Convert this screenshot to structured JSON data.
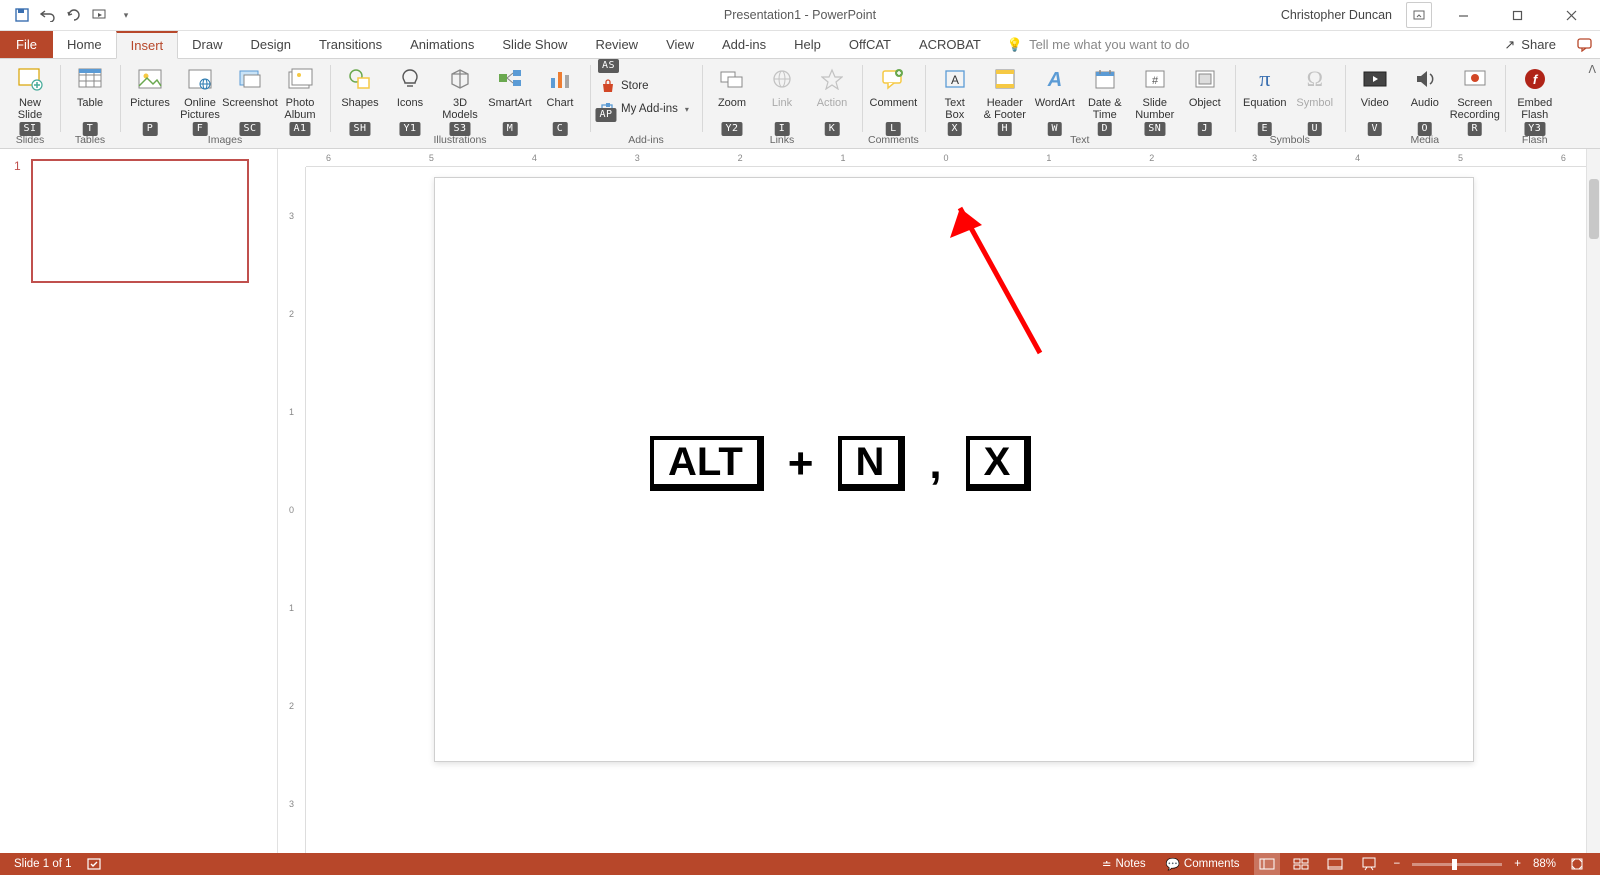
{
  "titlebar": {
    "doc_title": "Presentation1 - PowerPoint",
    "user": "Christopher Duncan"
  },
  "tabs": {
    "file": "File",
    "items": [
      "Home",
      "Insert",
      "Draw",
      "Design",
      "Transitions",
      "Animations",
      "Slide Show",
      "Review",
      "View",
      "Add-ins",
      "Help",
      "OffCAT",
      "ACROBAT"
    ],
    "active_index": 1,
    "tellme_placeholder": "Tell me what you want to do",
    "share": "Share"
  },
  "ribbon": {
    "groups": {
      "slides": {
        "label": "Slides",
        "new_slide": "New\nSlide",
        "keytip_newslide": "SI"
      },
      "tables": {
        "label": "Tables",
        "table": "Table",
        "keytip": "T"
      },
      "images": {
        "label": "Images",
        "pictures": "Pictures",
        "online_pictures": "Online\nPictures",
        "screenshot": "Screenshot",
        "photo_album": "Photo\nAlbum",
        "keytips": {
          "pictures": "P",
          "online": "F",
          "screenshot": "SC",
          "album": "A1"
        }
      },
      "illustrations": {
        "label": "Illustrations",
        "shapes": "Shapes",
        "icons": "Icons",
        "models": "3D\nModels",
        "smartart": "SmartArt",
        "chart": "Chart",
        "keytips": {
          "shapes": "SH",
          "icons": "Y1",
          "models": "S3",
          "smartart": "M",
          "chart": "C"
        }
      },
      "addins": {
        "label": "Add-ins",
        "store": "Store",
        "myaddins": "My Add-ins",
        "keytips": {
          "store": "AS",
          "myaddins": "AP"
        }
      },
      "links": {
        "label": "Links",
        "zoom": "Zoom",
        "link": "Link",
        "action": "Action",
        "keytips": {
          "zoom": "Y2",
          "link": "I",
          "action": "K"
        }
      },
      "comments": {
        "label": "Comments",
        "comment": "Comment",
        "keytip": "L"
      },
      "text": {
        "label": "Text",
        "textbox": "Text\nBox",
        "header": "Header\n& Footer",
        "wordart": "WordArt",
        "datetime": "Date &\nTime",
        "slidenum": "Slide\nNumber",
        "object": "Object",
        "keytips": {
          "textbox": "X",
          "header": "H",
          "wordart": "W",
          "datetime": "D",
          "slidenum": "SN",
          "object": "J"
        }
      },
      "symbols": {
        "label": "Symbols",
        "equation": "Equation",
        "symbol": "Symbol",
        "keytips": {
          "equation": "E",
          "symbol": "U"
        }
      },
      "media": {
        "label": "Media",
        "video": "Video",
        "audio": "Audio",
        "screenrec": "Screen\nRecording",
        "keytips": {
          "video": "V",
          "audio": "O",
          "screenrec": "R"
        }
      },
      "flash": {
        "label": "Flash",
        "embed": "Embed\nFlash",
        "keytip": "Y3"
      }
    }
  },
  "ruler_h": [
    "6",
    "5",
    "4",
    "3",
    "2",
    "1",
    "0",
    "1",
    "2",
    "3",
    "4",
    "5",
    "6"
  ],
  "ruler_v": [
    "3",
    "2",
    "1",
    "0",
    "1",
    "2",
    "3"
  ],
  "thumbs": {
    "slide_number": "1"
  },
  "slide_content": {
    "key1": "ALT",
    "plus": "+",
    "key2": "N",
    "comma": ",",
    "key3": "X"
  },
  "statusbar": {
    "slide_info": "Slide 1 of 1",
    "notes": "Notes",
    "comments": "Comments",
    "zoom": "88%"
  }
}
